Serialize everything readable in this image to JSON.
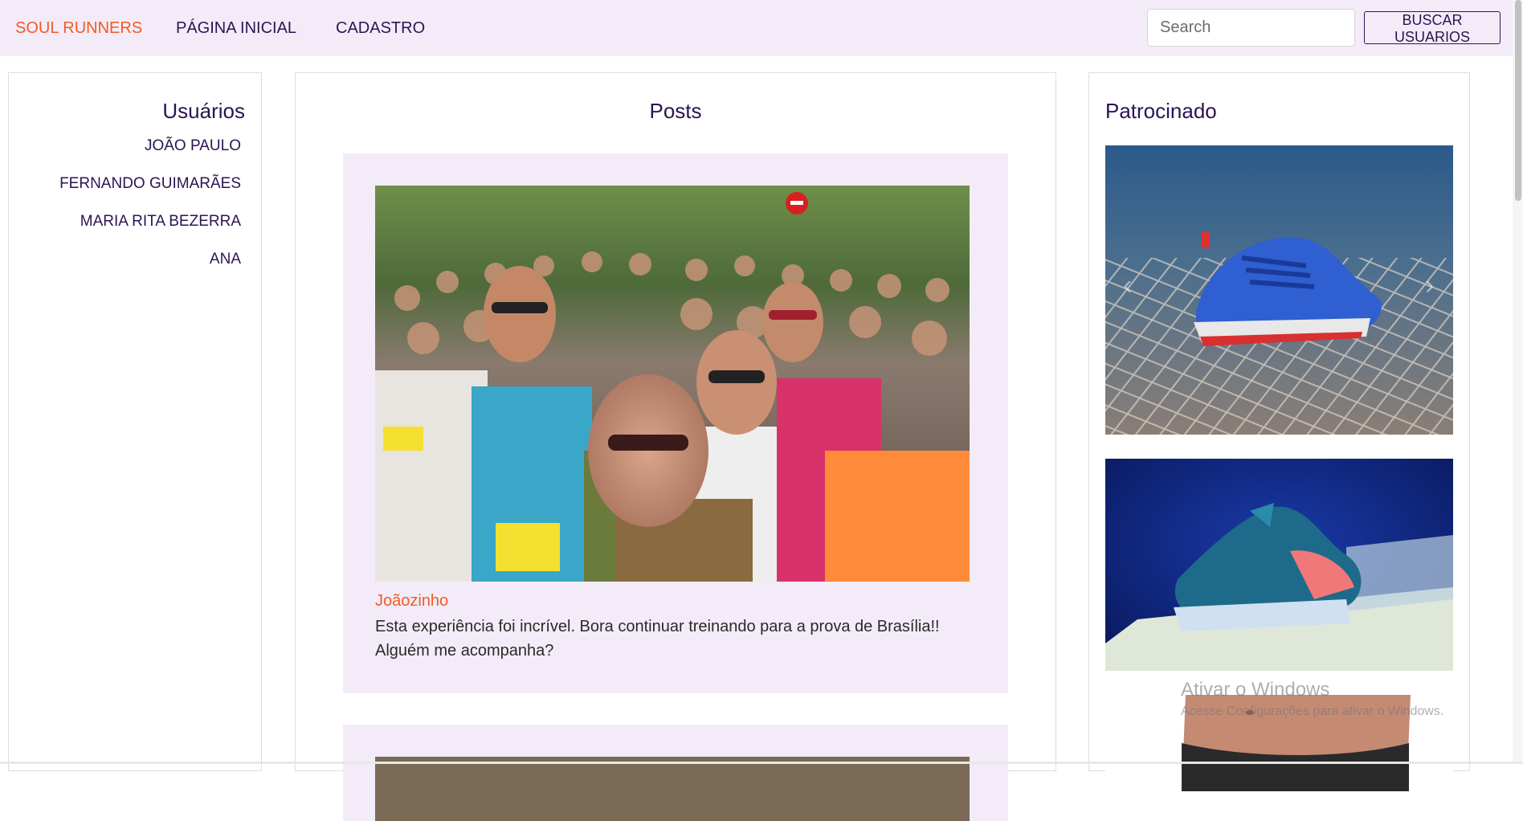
{
  "navbar": {
    "brand": "SOUL RUNNERS",
    "links": [
      "PÁGINA INICIAL",
      "CADASTRO"
    ],
    "search_placeholder": "Search",
    "search_button": "BUSCAR USUARIOS"
  },
  "users": {
    "title": "Usuários",
    "items": [
      "JOÃO PAULO",
      "FERNANDO GUIMARÃES",
      "MARIA RITA BEZERRA",
      "ANA"
    ]
  },
  "posts": {
    "title": "Posts",
    "items": [
      {
        "author": "Joãozinho",
        "text": "Esta experiência foi incrível. Bora continuar treinando para a prova de Brasília!! Alguém me acompanha?",
        "image": "marathon-runners-photo"
      },
      {
        "image": "runners-photo-partial"
      }
    ]
  },
  "sponsored": {
    "title": "Patrocinado",
    "ads": [
      {
        "image": "blue-sneaker-on-net-photo"
      },
      {
        "image": "blue-pink-sneaker-on-pedestal-photo"
      },
      {
        "image": "person-torso-photo-partial"
      }
    ]
  },
  "watermark": {
    "title": "Ativar o Windows",
    "subtitle": "Acesse Configurações para ativar o Windows."
  },
  "colors": {
    "accent": "#f25a24",
    "primary_text": "#2b1454",
    "navbar_bg": "#f3ecf8",
    "card_bg": "#f3ecf8"
  }
}
